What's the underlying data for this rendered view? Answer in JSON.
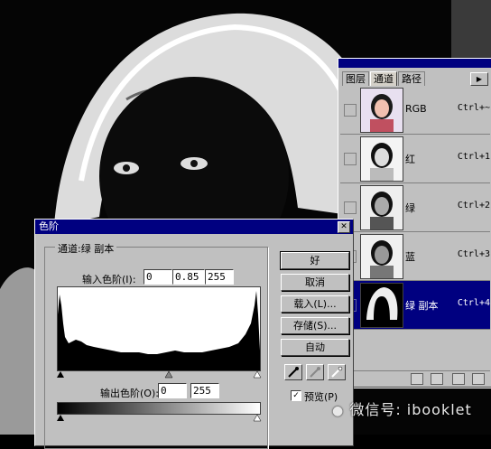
{
  "channels": {
    "tabs": [
      "图层",
      "通道",
      "路径"
    ],
    "active_tab": 1,
    "rows": [
      {
        "name": "RGB",
        "key": "Ctrl+~"
      },
      {
        "name": "红",
        "key": "Ctrl+1"
      },
      {
        "name": "绿",
        "key": "Ctrl+2"
      },
      {
        "name": "蓝",
        "key": "Ctrl+3"
      },
      {
        "name": "绿 副本",
        "key": "Ctrl+4",
        "selected": true
      }
    ]
  },
  "levels": {
    "title": "色阶",
    "channel_label": "通道:",
    "channel_value": "绿 副本",
    "input_label": "输入色阶(I):",
    "input_black": "0",
    "input_gamma": "0.85",
    "input_white": "255",
    "output_label": "输出色阶(O):",
    "output_black": "0",
    "output_white": "255",
    "buttons": {
      "ok": "好",
      "cancel": "取消",
      "load": "载入(L)...",
      "save": "存储(S)...",
      "auto": "自动"
    },
    "preview_label": "预览(P)",
    "preview_checked": true
  },
  "watermark": "微信号: ibooklet",
  "colors": {
    "titlebar": "#000080",
    "dialog": "#c0c0c0"
  }
}
